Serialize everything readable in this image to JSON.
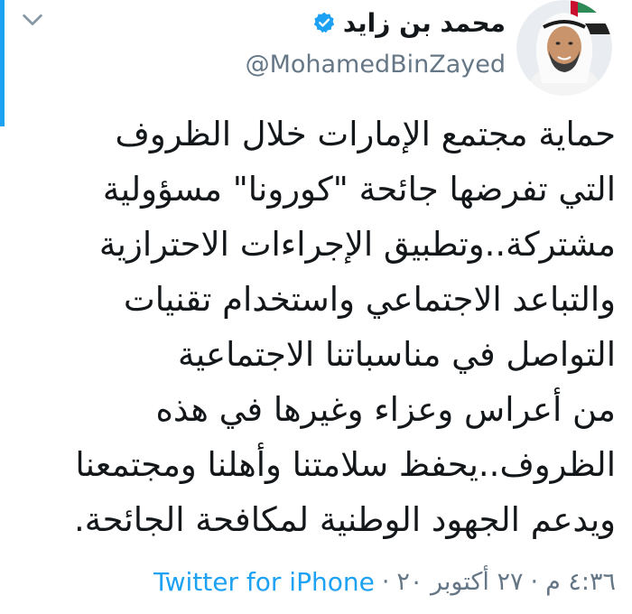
{
  "author": {
    "display_name": "محمد بن زايد",
    "handle": "@MohamedBinZayed",
    "verified": true,
    "avatar_icon": "profile-photo"
  },
  "tweet": {
    "lines": [
      "حماية مجتمع الإمارات خلال الظروف",
      "التي تفرضها جائحة \"كورونا\" مسؤولية",
      "مشتركة..وتطبيق الإجراءات الاحترازية",
      "والتباعد الاجتماعي واستخدام تقنيات",
      "التواصل في مناسباتنا الاجتماعية",
      "من أعراس وعزاء وغيرها في هذه",
      "الظروف..يحفظ سلامتنا وأهلنا ومجتمعنا",
      "ويدعم الجهود الوطنية لمكافحة الجائحة."
    ]
  },
  "meta": {
    "time": "٤:٣٦ م",
    "date": "٢٧ أكتوبر ٢٠",
    "separator": "·",
    "source": "Twitter for iPhone"
  },
  "colors": {
    "accent": "#1da1f2",
    "text": "#14171a",
    "secondary": "#657786"
  }
}
